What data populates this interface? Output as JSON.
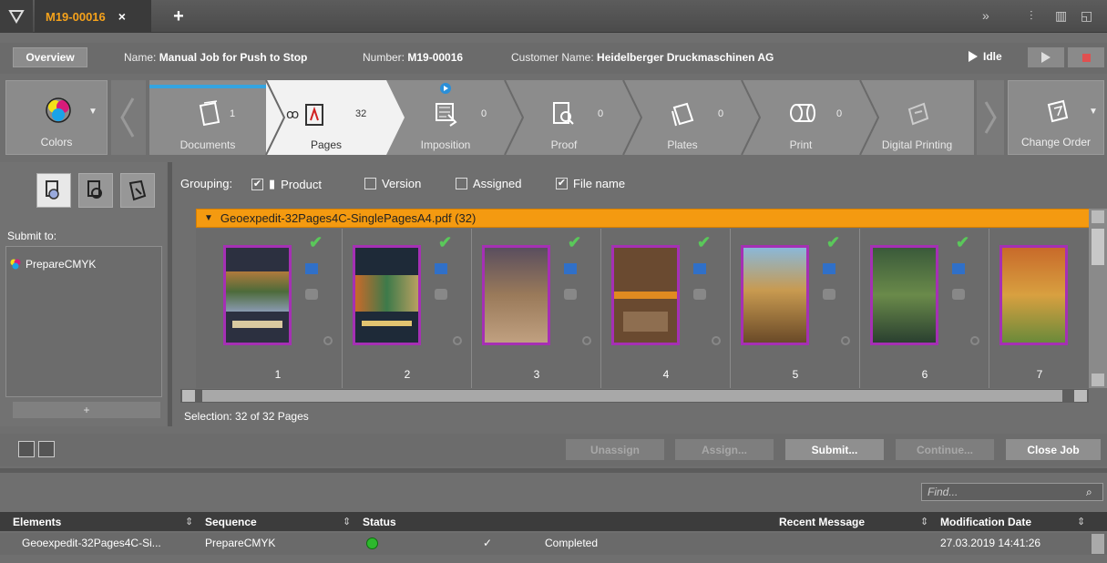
{
  "tab": {
    "title": "M19-00016",
    "close": "×",
    "add": "+"
  },
  "info": {
    "overview": "Overview",
    "name_label": "Name:",
    "name_value": "Manual Job for Push to Stop",
    "number_label": "Number:",
    "number_value": "M19-00016",
    "customer_label": "Customer Name:",
    "customer_value": "Heidelberger Druckmaschinen AG",
    "status": "Idle"
  },
  "workflow": {
    "colors": "Colors",
    "change_order": "Change Order",
    "steps": [
      {
        "label": "Documents",
        "count": "1"
      },
      {
        "label": "Pages",
        "count": "32"
      },
      {
        "label": "Imposition",
        "count": "0"
      },
      {
        "label": "Proof",
        "count": "0"
      },
      {
        "label": "Plates",
        "count": "0"
      },
      {
        "label": "Print",
        "count": "0"
      },
      {
        "label": "Digital Printing",
        "count": ""
      }
    ]
  },
  "left": {
    "submit_to": "Submit to:",
    "item": "PrepareCMYK",
    "plus": "+"
  },
  "grouping": {
    "label": "Grouping:",
    "options": [
      {
        "label": "Product",
        "checked": true
      },
      {
        "label": "Version",
        "checked": false
      },
      {
        "label": "Assigned",
        "checked": false
      },
      {
        "label": "File name",
        "checked": true
      }
    ]
  },
  "group_header": "Geoexpedit-32Pages4C-SinglePagesA4.pdf (32)",
  "pages": [
    "1",
    "2",
    "3",
    "4",
    "5",
    "6",
    "7"
  ],
  "selection": "Selection:  32 of 32 Pages",
  "actions": {
    "unassign": "Unassign",
    "assign": "Assign...",
    "submit": "Submit...",
    "continue": "Continue...",
    "close": "Close Job"
  },
  "table": {
    "find_placeholder": "Find...",
    "headers": [
      "Elements",
      "Sequence",
      "Status",
      "Recent Message",
      "Modification Date"
    ],
    "row": {
      "element": "Geoexpedit-32Pages4C-Si...",
      "sequence": "PrepareCMYK",
      "check": "✓",
      "status": "Completed",
      "message": "",
      "date": "27.03.2019 14:41:26"
    }
  },
  "colors": {
    "accent": "#f49a10",
    "tab_text": "#f5a21b",
    "thumb_border": "#a530b4",
    "ok": "#5ac85a"
  }
}
